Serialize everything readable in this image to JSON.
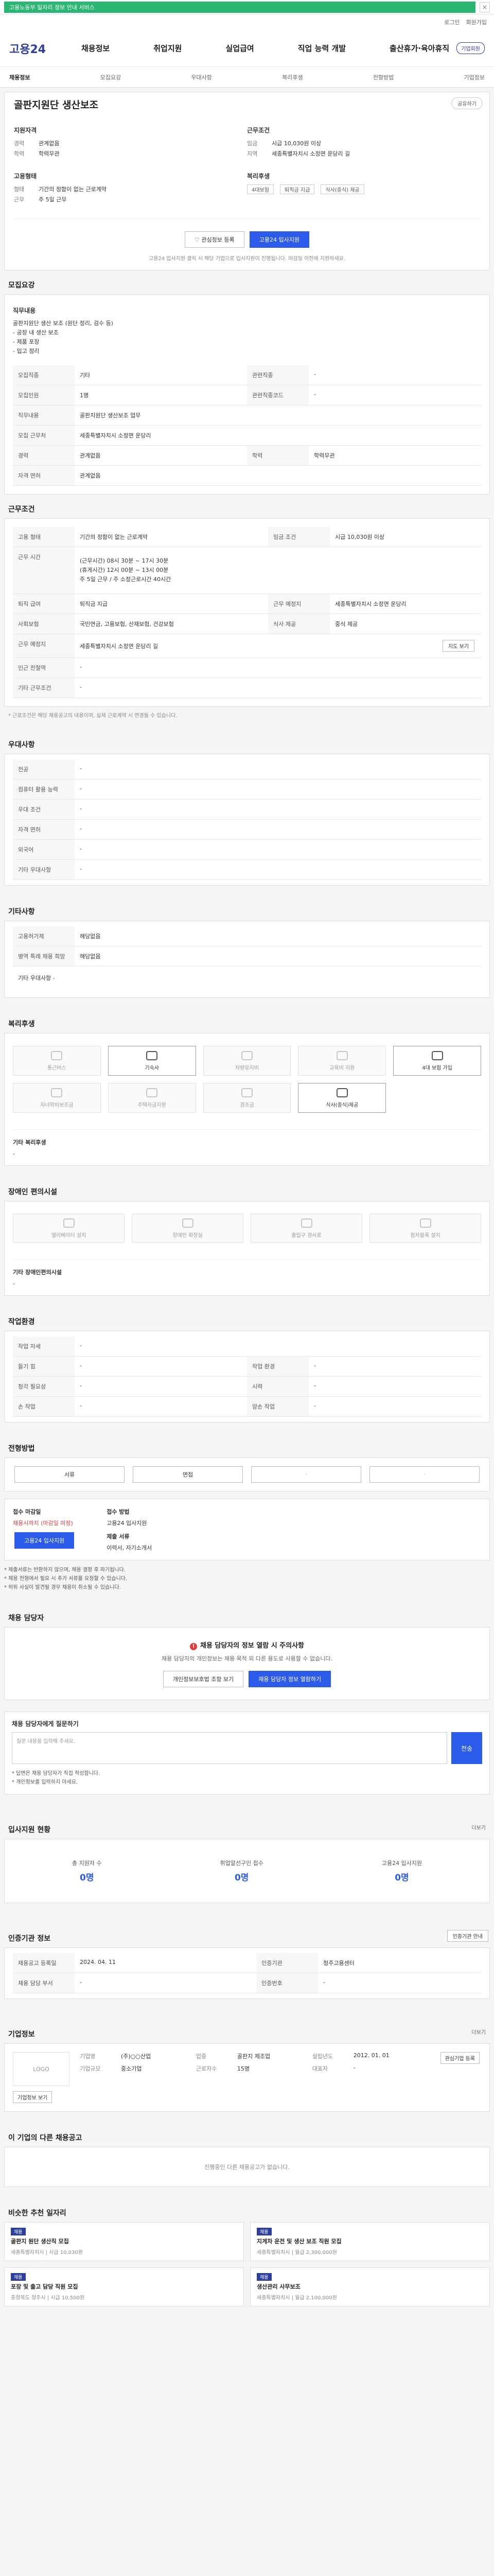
{
  "topbar": {
    "notice": "고용노동부 일자리 정보 안내 서비스",
    "close": "×"
  },
  "util": [
    "로그인",
    "회원가입"
  ],
  "gnb": {
    "logo": "고용24",
    "nav": [
      "채용정보",
      "취업지원",
      "실업급여",
      "직업 능력 개발",
      "출산휴가·육아휴직"
    ],
    "biz": "기업회원"
  },
  "subnav": {
    "items": [
      "채용정보",
      "모집요강",
      "우대사항",
      "복리후생",
      "전형방법",
      "기업정보"
    ]
  },
  "hero": {
    "title": "골판지원단 생산보조",
    "share": "공유하기",
    "left_title": "지원자격",
    "left": [
      {
        "k": "경력",
        "v": "관계없음"
      },
      {
        "k": "학력",
        "v": "학력무관"
      }
    ],
    "right_title": "근무조건",
    "right": [
      {
        "k": "임금",
        "v": "시급 10,030원 이상"
      },
      {
        "k": "지역",
        "v": "세종특별자치시 소정면 운당리 길"
      }
    ],
    "left2_title": "고용형태",
    "left2": [
      {
        "k": "형태",
        "v": "기간의 정함이 없는 근로계약"
      },
      {
        "k": "근무",
        "v": "주 5일 근무"
      }
    ],
    "right2_title": "복리후생",
    "tags": [
      "4대보험",
      "퇴직금 지급",
      "식사(중식) 제공"
    ],
    "btn_like": "관심정보 등록",
    "btn_apply": "고용24 입사지원",
    "foot_note": "고용24 입사지원 클릭 시 해당 기업으로 입사지원이 진행됩니다. 마감일 이전에 지원하세요."
  },
  "recruit": {
    "title": "모집요강",
    "duty_label": "직무내용",
    "duty": "골판지원단 생산 보조 (원단 정리, 검수 등)\n- 공장 내 생산 보조\n- 제품 포장\n- 입고 정리",
    "rows": [
      {
        "k": "모집직종",
        "v": "기타",
        "k2": "관련직종",
        "v2": "-"
      },
      {
        "k": "모집인원",
        "v": "1명",
        "k2": "관련직종코드",
        "v2": "-"
      },
      {
        "k": "직무내용",
        "v": "골판지원단 생산보조 업무",
        "k2": "",
        "v2": ""
      },
      {
        "k": "모집 근무처",
        "v": "세종특별자치시 소정면 운당리",
        "k2": "",
        "v2": ""
      },
      {
        "k": "경력",
        "v": "관계없음",
        "k2": "학력",
        "v2": "학력무관"
      },
      {
        "k": "자격 면허",
        "v": "관계없음",
        "k2": "",
        "v2": ""
      }
    ]
  },
  "conditions": {
    "title": "근무조건",
    "rows": [
      {
        "k": "고용 형태",
        "v": "기간의 정함이 없는 근로계약",
        "k2": "임금 조건",
        "v2": "시급 10,030원 이상"
      },
      {
        "k": "근무 시간",
        "v": "(근무시간) 08시 30분 ~ 17시 30분\n(휴게시간) 12시 00분 ~ 13시 00분\n주 5일 근무 / 주 소정근로시간 40시간",
        "k2": "",
        "v2": ""
      },
      {
        "k": "퇴직 급여",
        "v": "퇴직금 지급",
        "k2": "근무 예정지",
        "v2": "세종특별자치시 소정면 운당리"
      },
      {
        "k": "사회보험",
        "v": "국민연금, 고용보험, 산재보험, 건강보험",
        "k2": "식사 제공",
        "v2": "중식 제공"
      },
      {
        "k": "근무 예정지",
        "v": "세종특별자치시 소정면 운당리 길",
        "k2": "",
        "v2": ""
      },
      {
        "k": "인근 전철역",
        "v": "-",
        "k2": "",
        "v2": ""
      },
      {
        "k": "기타 근무조건",
        "v": "-",
        "k2": "",
        "v2": ""
      }
    ],
    "map_btn": "지도 보기",
    "note": "* 근로조건은 해당 채용공고의 내용이며, 실제 근로계약 시 변경될 수 있습니다."
  },
  "preference": {
    "title": "우대사항",
    "rows": [
      {
        "k": "전공",
        "v": "-"
      },
      {
        "k": "컴퓨터 활용 능력",
        "v": "-"
      },
      {
        "k": "우대 조건",
        "v": "-"
      },
      {
        "k": "자격 면허",
        "v": "-"
      },
      {
        "k": "외국어",
        "v": "-"
      },
      {
        "k": "기타 우대사항",
        "v": "-"
      }
    ]
  },
  "etc": {
    "title": "기타사항",
    "rows": [
      {
        "k": "고용허가제",
        "v": "해당없음"
      },
      {
        "k": "병역 특례 채용 희망",
        "v": "해당없음"
      }
    ],
    "more": "기타 우대사항 -"
  },
  "welfare": {
    "title": "복리후생",
    "items": [
      {
        "label": "통근버스",
        "on": false
      },
      {
        "label": "기숙사",
        "on": false
      },
      {
        "label": "차량유지비",
        "on": false
      },
      {
        "label": "교육비 지원",
        "on": false
      },
      {
        "label": "4대 보험 가입",
        "on": true
      },
      {
        "label": "자녀학비보조금",
        "on": false
      },
      {
        "label": "주택자금지원",
        "on": false
      },
      {
        "label": "경조금",
        "on": false
      },
      {
        "label": "식사(중식)제공",
        "on": true
      }
    ],
    "etc_label": "기타 복리후생",
    "etc_value": "-"
  },
  "disability": {
    "title": "장애인 편의시설",
    "items": [
      "엘리베이터 설치",
      "장애인 화장실",
      "출입구 경사로",
      "점자블록 설치"
    ],
    "etc_label": "기타 장애인편의시설",
    "etc_value": "-"
  },
  "environment": {
    "title": "작업환경",
    "rows": [
      {
        "k": "작업 자세",
        "v": "-",
        "k2": "",
        "v2": ""
      },
      {
        "k": "들기 힘",
        "v": "-",
        "k2": "작업 환경",
        "v2": "-"
      },
      {
        "k": "청각 필요성",
        "v": "-",
        "k2": "시력",
        "v2": "-"
      },
      {
        "k": "손 작업",
        "v": "-",
        "k2": "양손 작업",
        "v2": "-"
      }
    ]
  },
  "process": {
    "title": "전형방법",
    "steps": [
      "서류",
      "면접",
      "-",
      "-"
    ],
    "apply_label": "접수 마감일",
    "apply_value": "채용시까지 (마감일 미정)",
    "method_label": "접수 방법",
    "method_value": "고용24 입사지원",
    "submit_label": "제출 서류",
    "submit_value": "이력서, 자기소개서",
    "apply_btn": "고용24 입사지원",
    "notes": [
      "* 제출서류는 반환하지 않으며, 채용 결정 후 파기됩니다.",
      "* 채용 전형에서 필요 시 추가 서류를 요청할 수 있습니다.",
      "* 허위 사실이 발견될 경우 채용이 취소될 수 있습니다."
    ]
  },
  "contact": {
    "title": "채용 담당자",
    "alert_title": "채용 담당자의 정보 열람 시 주의사항",
    "alert_body": "채용 담당자의 개인정보는 채용 목적 외 다른 용도로 사용할 수 없습니다.",
    "btn1": "개인정보보호법 조항 보기",
    "btn2": "채용 담당자 정보 열람하기"
  },
  "qa": {
    "title": "채용 담당자에게 질문하기",
    "placeholder": "질문 내용을 입력해 주세요.",
    "go": "전송",
    "notes": [
      "* 답변은 채용 담당자가 직접 작성합니다.",
      "* 개인정보를 입력하지 마세요."
    ]
  },
  "stats": {
    "title": "입사지원 현황",
    "more": "더보기",
    "items": [
      {
        "l": "총 지원자 수",
        "n": "0명"
      },
      {
        "l": "취업알선구인 접수",
        "n": "0명"
      },
      {
        "l": "고용24 입사지원",
        "n": "0명"
      }
    ]
  },
  "info": {
    "title": "인증기관 정보",
    "btn": "인증기관 안내",
    "rows": [
      {
        "k": "채용공고 등록일",
        "v": "2024. 04. 11",
        "k2": "인증기관",
        "v2": "청주고용센터"
      },
      {
        "k": "채용 담당 부서",
        "v": "-",
        "k2": "인증번호",
        "v2": "-"
      }
    ]
  },
  "company": {
    "title": "기업정보",
    "more": "더보기",
    "logo": "LOGO",
    "info": [
      {
        "k": "기업명",
        "v": "(주)○○산업"
      },
      {
        "k": "업종",
        "v": "골판지 제조업"
      },
      {
        "k": "설립년도",
        "v": "2012. 01. 01"
      },
      {
        "k": "기업규모",
        "v": "중소기업"
      },
      {
        "k": "근로자수",
        "v": "15명"
      },
      {
        "k": "대표자",
        "v": "-"
      }
    ],
    "btn1": "기업정보 보기",
    "btn2": "관심기업 등록"
  },
  "same_company": {
    "title": "이 기업의 다른 채용공고",
    "empty": "진행중인 다른 채용공고가 없습니다."
  },
  "recommend": {
    "title": "비슷한 추천 일자리",
    "items": [
      {
        "badge": "채용",
        "title": "골판지 원단 생산직 모집",
        "meta": "세종특별자치시 | 시급 10,030원"
      },
      {
        "badge": "채용",
        "title": "지게차 운전 및 생산 보조 직원 모집",
        "meta": "세종특별자치시 | 월급 2,300,000원"
      },
      {
        "badge": "채용",
        "title": "포장 및 출고 담당 직원 모집",
        "meta": "충청북도 청주시 | 시급 10,500원"
      },
      {
        "badge": "채용",
        "title": "생산관리 사무보조",
        "meta": "세종특별자치시 | 월급 2,100,000원"
      }
    ]
  }
}
